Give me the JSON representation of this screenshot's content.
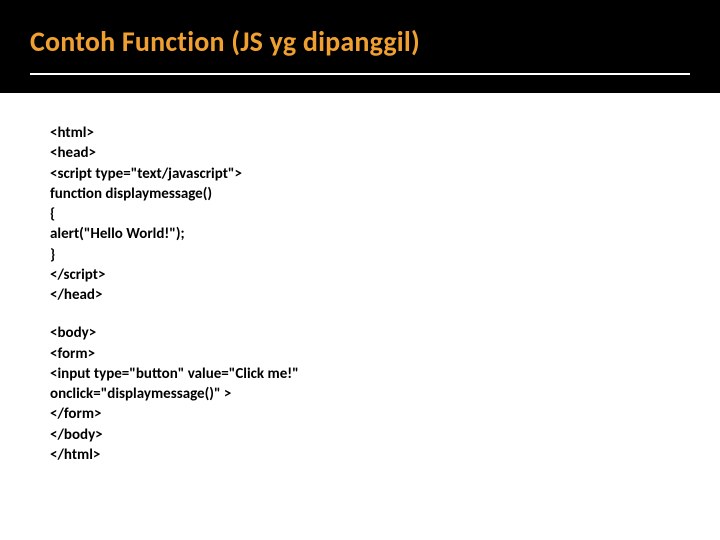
{
  "title": "Contoh Function (JS yg dipanggil)",
  "code": {
    "block1": [
      "<html>",
      "<head>",
      "<script type=\"text/javascript\">",
      "function displaymessage()",
      "{",
      "alert(\"Hello World!\");",
      "}",
      "</script>",
      "</head>"
    ],
    "block2": [
      "<body>",
      "<form>",
      "<input type=\"button\" value=\"Click me!\"",
      "onclick=\"displaymessage()\" >",
      "</form>",
      "</body>",
      "</html>"
    ]
  }
}
